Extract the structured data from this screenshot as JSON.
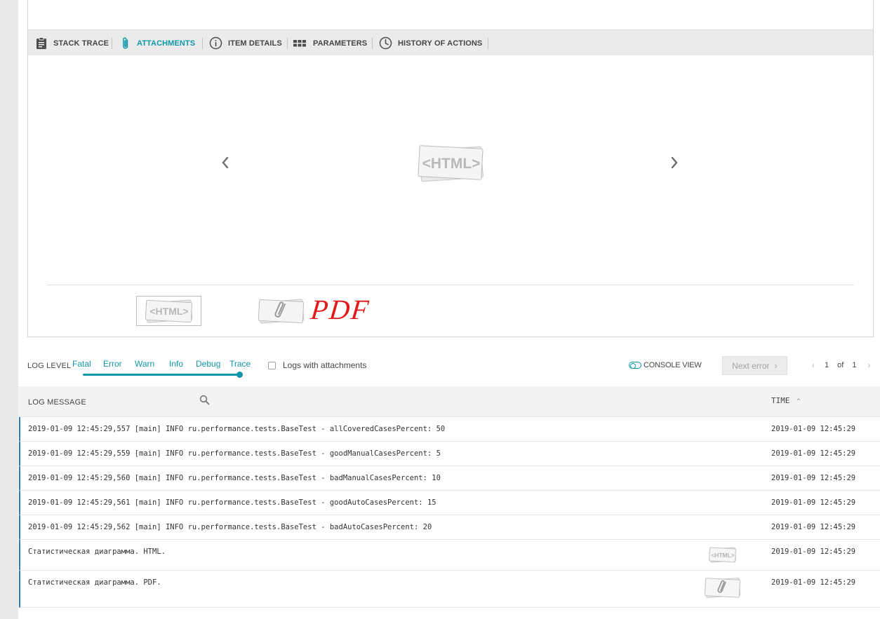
{
  "tabs": [
    {
      "label": "STACK TRACE",
      "icon": "clipboard-icon",
      "active": false
    },
    {
      "label": "ATTACHMENTS",
      "icon": "paperclip-icon",
      "active": true
    },
    {
      "label": "ITEM DETAILS",
      "icon": "info-icon",
      "active": false
    },
    {
      "label": "PARAMETERS",
      "icon": "grid-icon",
      "active": false
    },
    {
      "label": "HISTORY OF ACTIONS",
      "icon": "clock-icon",
      "active": false
    }
  ],
  "attachments": {
    "preview_text": "<HTML>",
    "thumb_html_text": "<HTML>",
    "pdf_annotation": "PDF"
  },
  "log_level": {
    "title": "LOG LEVEL",
    "levels": [
      "Fatal",
      "Error",
      "Warn",
      "Info",
      "Debug",
      "Trace"
    ],
    "selected": "Trace",
    "logs_with_attachments_label": "Logs with attachments",
    "logs_with_attachments_checked": false,
    "console_view_label": "CONSOLE VIEW",
    "next_error_label": "Next error",
    "pager": {
      "current": "1",
      "of": "of",
      "total": "1"
    }
  },
  "table": {
    "header_message": "LOG MESSAGE",
    "header_time": "TIME",
    "sort_indicator": "^",
    "rows": [
      {
        "message": "2019-01-09 12:45:29,557 [main] INFO ru.performance.tests.BaseTest - allCoveredCasesPercent: 50",
        "time": "2019-01-09 12:45:29"
      },
      {
        "message": "2019-01-09 12:45:29,559 [main] INFO ru.performance.tests.BaseTest - goodManualCasesPercent: 5",
        "time": "2019-01-09 12:45:29"
      },
      {
        "message": "2019-01-09 12:45:29,560 [main] INFO ru.performance.tests.BaseTest - badManualCasesPercent: 10",
        "time": "2019-01-09 12:45:29"
      },
      {
        "message": "2019-01-09 12:45:29,561 [main] INFO ru.performance.tests.BaseTest - goodAutoCasesPercent: 15",
        "time": "2019-01-09 12:45:29"
      },
      {
        "message": "2019-01-09 12:45:29,562 [main] INFO ru.performance.tests.BaseTest - badAutoCasesPercent: 20",
        "time": "2019-01-09 12:45:29"
      },
      {
        "message": "Статистическая диаграмма. HTML.",
        "time": "2019-01-09 12:45:29",
        "attachment_text": "<HTML>"
      },
      {
        "message": "Статистическая диаграмма. PDF.",
        "time": "2019-01-09 12:45:29"
      }
    ]
  },
  "colors": {
    "accent": "#0f97a9",
    "row_border": "#2c7fb8",
    "pdf_annotation": "#e31a1a"
  }
}
